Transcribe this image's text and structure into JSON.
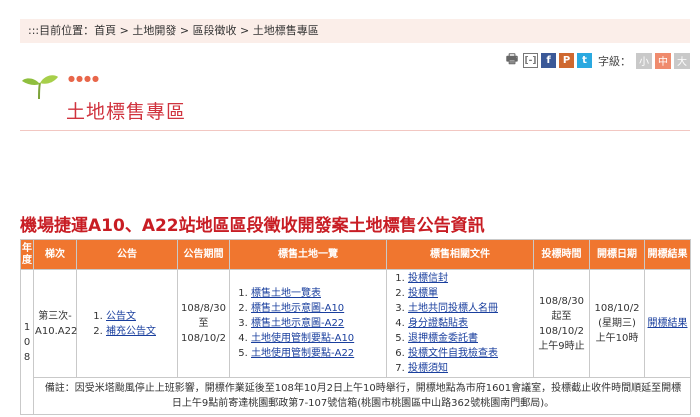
{
  "breadcrumb": {
    "prefix": ":::目前位置：",
    "items": [
      "首頁",
      "土地開發",
      "區段徵收",
      "土地標售專區"
    ],
    "separator": " > "
  },
  "toolbar": {
    "print_icon": "print-icon",
    "share_icon": "share-bracket-icon",
    "facebook_label": "f",
    "plurk_label": "P",
    "twitter_label": "t",
    "font_size_label": "字級：",
    "font_sizes": [
      "小",
      "中",
      "大"
    ],
    "active_font_size": "中"
  },
  "section_title": "土地標售專區",
  "page_heading": "機場捷運A10、A22站地區區段徵收開發案土地標售公告資訊",
  "table": {
    "headers": [
      "年度",
      "梯次",
      "公告",
      "公告期間",
      "標售土地一覽",
      "標售相關文件",
      "投標時間",
      "開標日期",
      "開標結果"
    ],
    "row": {
      "year_chars": [
        "1",
        "0",
        "8"
      ],
      "batch": "第三次-A10.A22",
      "announcements": [
        "公告文",
        "補充公告文"
      ],
      "period": [
        "108/8/30",
        "至",
        "108/10/2"
      ],
      "land_list": [
        "標售土地一覽表",
        "標售土地示意圖-A10",
        "標售土地示意圖-A22",
        "土地使用管制要點-A10",
        "土地使用管制要點-A22"
      ],
      "documents": [
        "投標信封",
        "投標單",
        "土地共同投標人名冊",
        "身分證黏貼表",
        "退押標金委託書",
        "投標文件自我檢查表",
        "投標須知"
      ],
      "bid_time": [
        "108/8/30",
        "起至",
        "108/10/2",
        "上午9時止"
      ],
      "open_date": [
        "108/10/2",
        "(星期三)",
        "上午10時"
      ],
      "result": "開標結果"
    },
    "note": "備註：因受米塔颱風停止上班影響，開標作業延後至108年10月2日上午10時舉行，開標地點為市府1601會議室，投標截止收件時間順延至開標日上午9點前寄達桃園郵政第7-107號信箱(桃園市桃園區中山路362號桃園南門郵局)。"
  },
  "colors": {
    "header_orange": "#f0762f",
    "heading_red": "#c81d24",
    "breadcrumb_bg": "#fbeee9",
    "link_blue": "#1a3f9e"
  }
}
